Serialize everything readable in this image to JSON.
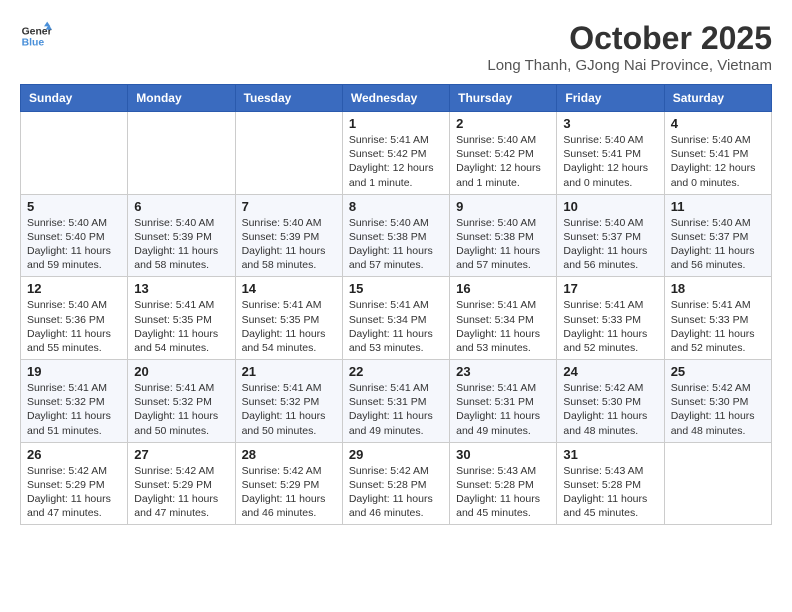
{
  "header": {
    "logo_line1": "General",
    "logo_line2": "Blue",
    "month_title": "October 2025",
    "location": "Long Thanh, GJong Nai Province, Vietnam"
  },
  "days_of_week": [
    "Sunday",
    "Monday",
    "Tuesday",
    "Wednesday",
    "Thursday",
    "Friday",
    "Saturday"
  ],
  "weeks": [
    [
      {
        "num": "",
        "detail": ""
      },
      {
        "num": "",
        "detail": ""
      },
      {
        "num": "",
        "detail": ""
      },
      {
        "num": "1",
        "detail": "Sunrise: 5:41 AM\nSunset: 5:42 PM\nDaylight: 12 hours\nand 1 minute."
      },
      {
        "num": "2",
        "detail": "Sunrise: 5:40 AM\nSunset: 5:42 PM\nDaylight: 12 hours\nand 1 minute."
      },
      {
        "num": "3",
        "detail": "Sunrise: 5:40 AM\nSunset: 5:41 PM\nDaylight: 12 hours\nand 0 minutes."
      },
      {
        "num": "4",
        "detail": "Sunrise: 5:40 AM\nSunset: 5:41 PM\nDaylight: 12 hours\nand 0 minutes."
      }
    ],
    [
      {
        "num": "5",
        "detail": "Sunrise: 5:40 AM\nSunset: 5:40 PM\nDaylight: 11 hours\nand 59 minutes."
      },
      {
        "num": "6",
        "detail": "Sunrise: 5:40 AM\nSunset: 5:39 PM\nDaylight: 11 hours\nand 58 minutes."
      },
      {
        "num": "7",
        "detail": "Sunrise: 5:40 AM\nSunset: 5:39 PM\nDaylight: 11 hours\nand 58 minutes."
      },
      {
        "num": "8",
        "detail": "Sunrise: 5:40 AM\nSunset: 5:38 PM\nDaylight: 11 hours\nand 57 minutes."
      },
      {
        "num": "9",
        "detail": "Sunrise: 5:40 AM\nSunset: 5:38 PM\nDaylight: 11 hours\nand 57 minutes."
      },
      {
        "num": "10",
        "detail": "Sunrise: 5:40 AM\nSunset: 5:37 PM\nDaylight: 11 hours\nand 56 minutes."
      },
      {
        "num": "11",
        "detail": "Sunrise: 5:40 AM\nSunset: 5:37 PM\nDaylight: 11 hours\nand 56 minutes."
      }
    ],
    [
      {
        "num": "12",
        "detail": "Sunrise: 5:40 AM\nSunset: 5:36 PM\nDaylight: 11 hours\nand 55 minutes."
      },
      {
        "num": "13",
        "detail": "Sunrise: 5:41 AM\nSunset: 5:35 PM\nDaylight: 11 hours\nand 54 minutes."
      },
      {
        "num": "14",
        "detail": "Sunrise: 5:41 AM\nSunset: 5:35 PM\nDaylight: 11 hours\nand 54 minutes."
      },
      {
        "num": "15",
        "detail": "Sunrise: 5:41 AM\nSunset: 5:34 PM\nDaylight: 11 hours\nand 53 minutes."
      },
      {
        "num": "16",
        "detail": "Sunrise: 5:41 AM\nSunset: 5:34 PM\nDaylight: 11 hours\nand 53 minutes."
      },
      {
        "num": "17",
        "detail": "Sunrise: 5:41 AM\nSunset: 5:33 PM\nDaylight: 11 hours\nand 52 minutes."
      },
      {
        "num": "18",
        "detail": "Sunrise: 5:41 AM\nSunset: 5:33 PM\nDaylight: 11 hours\nand 52 minutes."
      }
    ],
    [
      {
        "num": "19",
        "detail": "Sunrise: 5:41 AM\nSunset: 5:32 PM\nDaylight: 11 hours\nand 51 minutes."
      },
      {
        "num": "20",
        "detail": "Sunrise: 5:41 AM\nSunset: 5:32 PM\nDaylight: 11 hours\nand 50 minutes."
      },
      {
        "num": "21",
        "detail": "Sunrise: 5:41 AM\nSunset: 5:32 PM\nDaylight: 11 hours\nand 50 minutes."
      },
      {
        "num": "22",
        "detail": "Sunrise: 5:41 AM\nSunset: 5:31 PM\nDaylight: 11 hours\nand 49 minutes."
      },
      {
        "num": "23",
        "detail": "Sunrise: 5:41 AM\nSunset: 5:31 PM\nDaylight: 11 hours\nand 49 minutes."
      },
      {
        "num": "24",
        "detail": "Sunrise: 5:42 AM\nSunset: 5:30 PM\nDaylight: 11 hours\nand 48 minutes."
      },
      {
        "num": "25",
        "detail": "Sunrise: 5:42 AM\nSunset: 5:30 PM\nDaylight: 11 hours\nand 48 minutes."
      }
    ],
    [
      {
        "num": "26",
        "detail": "Sunrise: 5:42 AM\nSunset: 5:29 PM\nDaylight: 11 hours\nand 47 minutes."
      },
      {
        "num": "27",
        "detail": "Sunrise: 5:42 AM\nSunset: 5:29 PM\nDaylight: 11 hours\nand 47 minutes."
      },
      {
        "num": "28",
        "detail": "Sunrise: 5:42 AM\nSunset: 5:29 PM\nDaylight: 11 hours\nand 46 minutes."
      },
      {
        "num": "29",
        "detail": "Sunrise: 5:42 AM\nSunset: 5:28 PM\nDaylight: 11 hours\nand 46 minutes."
      },
      {
        "num": "30",
        "detail": "Sunrise: 5:43 AM\nSunset: 5:28 PM\nDaylight: 11 hours\nand 45 minutes."
      },
      {
        "num": "31",
        "detail": "Sunrise: 5:43 AM\nSunset: 5:28 PM\nDaylight: 11 hours\nand 45 minutes."
      },
      {
        "num": "",
        "detail": ""
      }
    ]
  ]
}
